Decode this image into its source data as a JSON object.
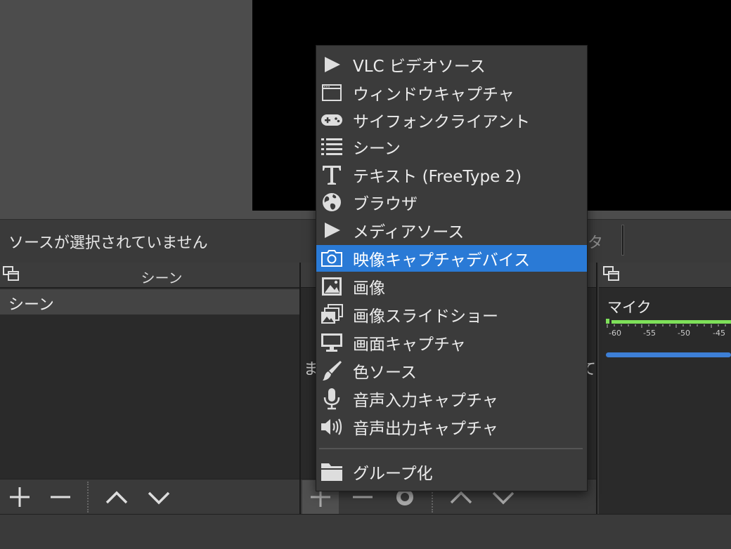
{
  "status": {
    "no_source_selected": "ソースが選択されていません",
    "right_partial": "タ"
  },
  "scenes_dock": {
    "title": "シーン",
    "items": [
      {
        "label": "シーン"
      }
    ]
  },
  "sources_dock": {
    "hint_left": "ま",
    "hint_right": "て"
  },
  "mixer_dock": {
    "channel_label": "マイク",
    "meter_ticks": [
      "-60",
      "-55",
      "-50",
      "-45"
    ]
  },
  "context_menu": {
    "items": [
      {
        "label": "VLC ビデオソース",
        "icon": "play-icon"
      },
      {
        "label": "ウィンドウキャプチャ",
        "icon": "window-icon"
      },
      {
        "label": "サイフォンクライアント",
        "icon": "gamepad-icon"
      },
      {
        "label": "シーン",
        "icon": "list-icon"
      },
      {
        "label": "テキスト (FreeType 2)",
        "icon": "text-icon"
      },
      {
        "label": "ブラウザ",
        "icon": "globe-icon"
      },
      {
        "label": "メディアソース",
        "icon": "play-icon"
      },
      {
        "label": "映像キャプチャデバイス",
        "icon": "camera-icon",
        "selected": true
      },
      {
        "label": "画像",
        "icon": "image-icon"
      },
      {
        "label": "画像スライドショー",
        "icon": "slideshow-icon"
      },
      {
        "label": "画面キャプチャ",
        "icon": "monitor-icon"
      },
      {
        "label": "色ソース",
        "icon": "brush-icon"
      },
      {
        "label": "音声入力キャプチャ",
        "icon": "microphone-icon"
      },
      {
        "label": "音声出力キャプチャ",
        "icon": "speaker-icon"
      }
    ],
    "group_item": {
      "label": "グループ化",
      "icon": "folder-icon"
    }
  },
  "colors": {
    "menu_highlight": "#2a7ad6",
    "meter_green": "#7ee05a",
    "volume_blue": "#3d7fd6"
  }
}
